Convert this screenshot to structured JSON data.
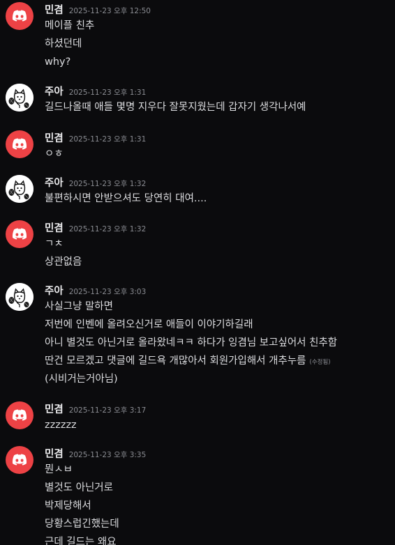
{
  "colors": {
    "background": "#0b0b0d",
    "discord_red": "#ed4245",
    "username": "#ececee",
    "timestamp": "#8b8d93",
    "text": "#dcdde0"
  },
  "messages": [
    {
      "user": "민겸",
      "avatar": "discord-logo-icon",
      "time": "2025-11-23 오후 12:50",
      "lines": [
        "메이플 친추",
        "하셨던데",
        "why?"
      ]
    },
    {
      "user": "주아",
      "avatar": "cat-sketch-avatar",
      "time": "2025-11-23 오후 1:31",
      "lines": [
        "길드나올때 애들 몇명 지우다 잘못지웠는데 갑자기 생각나서예"
      ]
    },
    {
      "user": "민겸",
      "avatar": "discord-logo-icon",
      "time": "2025-11-23 오후 1:31",
      "lines": [
        "ㅇㅎ"
      ]
    },
    {
      "user": "주아",
      "avatar": "cat-sketch-avatar",
      "time": "2025-11-23 오후 1:32",
      "lines": [
        "불편하시면 안받으셔도 당연히 대여...."
      ]
    },
    {
      "user": "민겸",
      "avatar": "discord-logo-icon",
      "time": "2025-11-23 오후 1:32",
      "lines": [
        "ㄱㅊ",
        "상관없음"
      ]
    },
    {
      "user": "주아",
      "avatar": "cat-sketch-avatar",
      "time": "2025-11-23 오후 3:03",
      "lines": [
        "사실그냥 말하면",
        "저번에 인벤에 올려오신거로 애들이 이야기하길래",
        "아니 별것도 아닌거로 올라왔네ㅋㅋ 하다가 잉겸님 보고싶어서 친추함",
        "딴건 모르겠고 댓글에 길드욕 개많아서 회원가입해서 개추누름",
        "(시비거는거아님)"
      ],
      "edited_label": "(수정됨)"
    },
    {
      "user": "민겸",
      "avatar": "discord-logo-icon",
      "time": "2025-11-23 오후 3:17",
      "lines": [
        "zzzzzz"
      ]
    },
    {
      "user": "민겸",
      "avatar": "discord-logo-icon",
      "time": "2025-11-23 오후 3:35",
      "lines": [
        "뭔ㅅㅂ",
        "별것도 아닌거로",
        "박제당해서",
        "당황스럽긴했는데",
        "근데 길드는 왜요"
      ]
    }
  ]
}
